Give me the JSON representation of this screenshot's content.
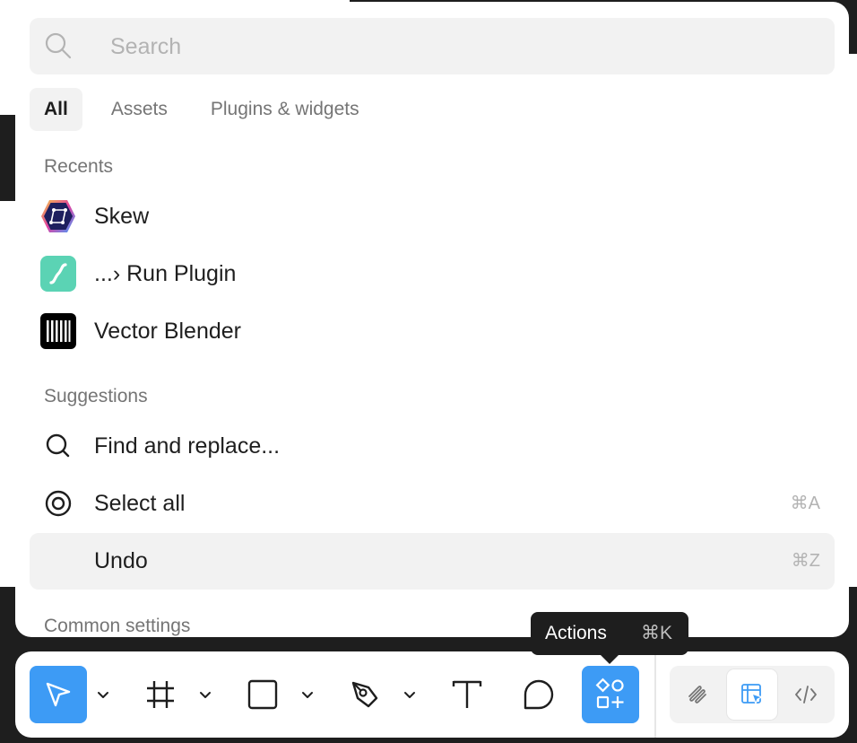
{
  "search": {
    "placeholder": "Search",
    "value": ""
  },
  "tabs": [
    {
      "label": "All",
      "active": true
    },
    {
      "label": "Assets",
      "active": false
    },
    {
      "label": "Plugins & widgets",
      "active": false
    }
  ],
  "recents": {
    "label": "Recents",
    "items": [
      {
        "label": "Skew",
        "icon": "skew-plugin-icon"
      },
      {
        "label": "...› Run Plugin",
        "icon": "run-plugin-icon"
      },
      {
        "label": "Vector Blender",
        "icon": "vector-blender-icon"
      }
    ]
  },
  "suggestions": {
    "label": "Suggestions",
    "items": [
      {
        "label": "Find and replace...",
        "icon": "search-icon",
        "shortcut": ""
      },
      {
        "label": "Select all",
        "icon": "target-icon",
        "shortcut": "⌘A"
      },
      {
        "label": "Undo",
        "icon": "",
        "shortcut": "⌘Z"
      }
    ]
  },
  "common_settings": {
    "label": "Common settings"
  },
  "tooltip": {
    "label": "Actions",
    "shortcut": "⌘K"
  },
  "toolbar": {
    "tools": [
      "move-tool",
      "frame-tool",
      "shape-tool",
      "pen-tool",
      "text-tool",
      "comment-tool",
      "actions-tool"
    ],
    "modes": [
      "draw-mode",
      "design-mode",
      "dev-mode"
    ],
    "accent": "#3d9bf5"
  }
}
